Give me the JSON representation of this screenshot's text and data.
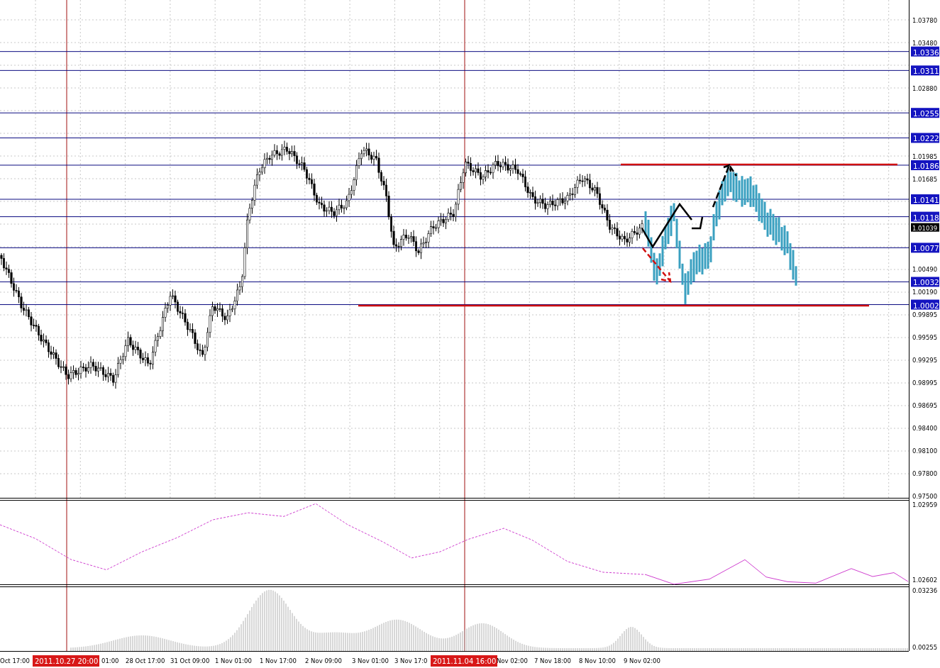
{
  "price_axis": {
    "ticks": [
      "1.03780",
      "1.03480",
      "1.02880",
      "1.01985",
      "1.01685",
      "1.00490",
      "1.00190",
      "0.99895",
      "0.99595",
      "0.99295",
      "0.98995",
      "0.98695",
      "0.98400",
      "0.98100",
      "0.97800",
      "0.97500"
    ]
  },
  "levels": [
    {
      "label": "1.0336"
    },
    {
      "label": "1.0311"
    },
    {
      "label": "1.0255"
    },
    {
      "label": "1.0222"
    },
    {
      "label": "1.0186"
    },
    {
      "label": "1.0141"
    },
    {
      "label": "1.0118"
    },
    {
      "label": "1.0077"
    },
    {
      "label": "1.0032"
    },
    {
      "label": "1.0002"
    }
  ],
  "current_price": {
    "label": "1.01039"
  },
  "time_axis": {
    "labels": [
      "Oct 17:00",
      "01:00",
      "28 Oct 17:00",
      "31 Oct 09:00",
      "1 Nov 01:00",
      "1 Nov 17:00",
      "2 Nov 09:00",
      "3 Nov 01:00",
      "3 Nov 17:0",
      "Nov 02:00",
      "7 Nov 18:00",
      "8 Nov 10:00",
      "9 Nov 02:00"
    ]
  },
  "markers": [
    {
      "label": "2011.10.27 20:00"
    },
    {
      "label": "2011.11.04 16:00"
    }
  ],
  "indicator_1": {
    "max": "1.02959",
    "min": "1.02602"
  },
  "indicator_2": {
    "max": "0.03236",
    "min": "0.00255"
  }
}
